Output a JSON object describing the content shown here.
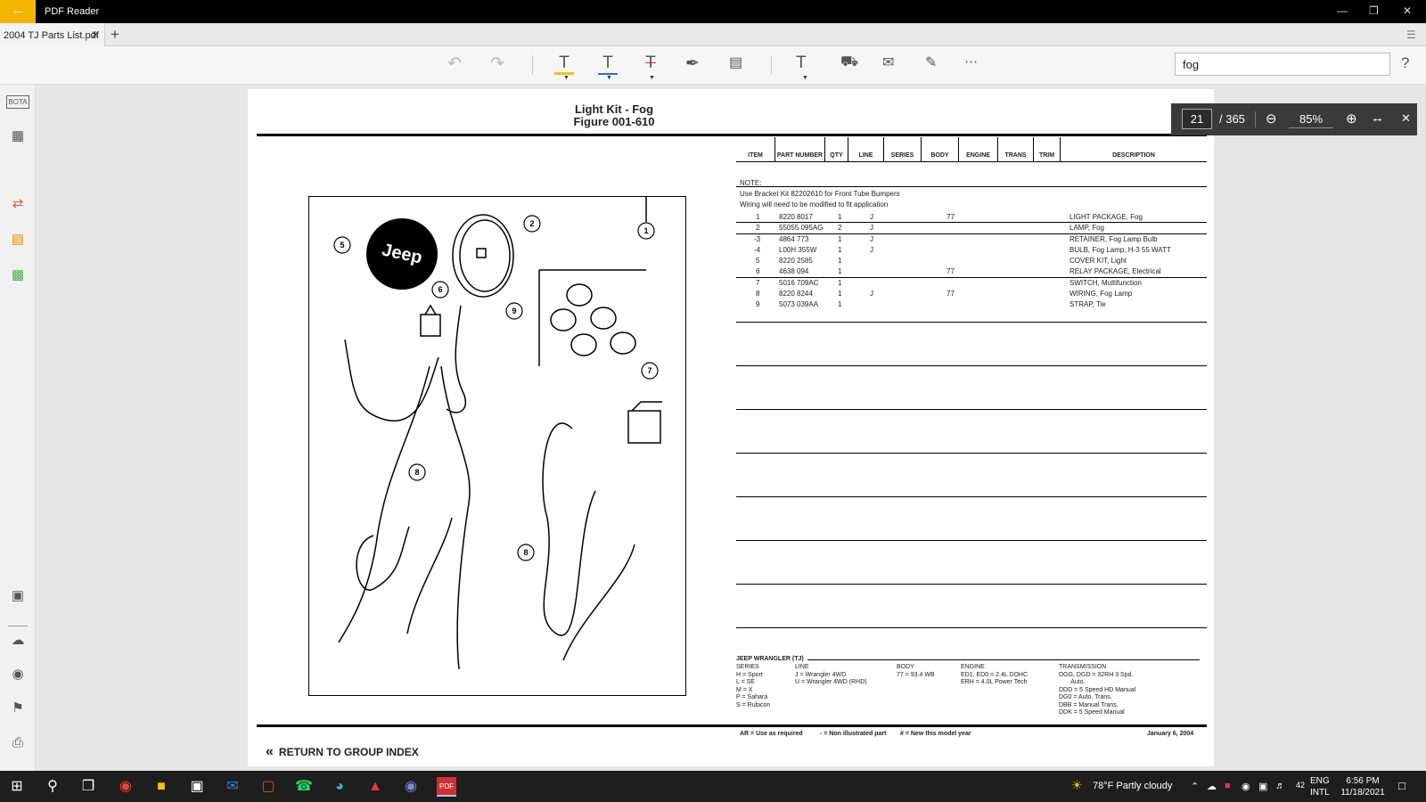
{
  "app": {
    "title": "PDF Reader"
  },
  "tab": {
    "label": "2004 TJ Parts List.pdf"
  },
  "search": {
    "value": "fog"
  },
  "sidebar": {
    "bota": "BOTA"
  },
  "page": {
    "title": "Light Kit - Fog",
    "figure": "Figure 001-610"
  },
  "pagectl": {
    "page": "21",
    "total": "/ 365",
    "zoom": "85%"
  },
  "table": {
    "headers": [
      "ITEM",
      "PART NUMBER",
      "QTY",
      "LINE",
      "SERIES",
      "BODY",
      "ENGINE",
      "TRANS",
      "TRIM",
      "DESCRIPTION"
    ],
    "notes": [
      "NOTE:",
      "Use Bracket Kit 82202610 for Front Tube Bumpers",
      "Wiring will need to be modified to fit application"
    ],
    "rows": [
      {
        "item": "1",
        "part": "8220 8017",
        "qty": "1",
        "line": "J",
        "body": "77",
        "desc": "LIGHT PACKAGE, Fog"
      },
      {
        "item": "2",
        "part": "55055 095AG",
        "qty": "2",
        "line": "J",
        "body": "",
        "desc": "LAMP, Fog"
      },
      {
        "item": "-3",
        "part": "4864 773",
        "qty": "1",
        "line": "J",
        "body": "",
        "desc": "RETAINER, Fog Lamp Bulb"
      },
      {
        "item": "-4",
        "part": "L00H 355W",
        "qty": "1",
        "line": "J",
        "body": "",
        "desc": "BULB, Fog Lamp, H-3 55 WATT"
      },
      {
        "item": "5",
        "part": "8220 2585",
        "qty": "1",
        "line": "",
        "body": "",
        "desc": "COVER KIT, Light"
      },
      {
        "item": "6",
        "part": "4638 094",
        "qty": "1",
        "line": "",
        "body": "77",
        "desc": "RELAY PACKAGE, Electrical"
      },
      {
        "item": "7",
        "part": "5016 709AC",
        "qty": "1",
        "line": "",
        "body": "",
        "desc": "SWITCH, Multifunction"
      },
      {
        "item": "8",
        "part": "8220 8244",
        "qty": "1",
        "line": "J",
        "body": "77",
        "desc": "WIRING, Fog Lamp"
      },
      {
        "item": "9",
        "part": "5073 039AA",
        "qty": "1",
        "line": "",
        "body": "",
        "desc": "STRAP, Tie"
      }
    ]
  },
  "figure": {
    "logo": "Jeep",
    "callouts": [
      "1",
      "2",
      "5",
      "6",
      "9",
      "7",
      "8",
      "8"
    ]
  },
  "legend": {
    "title": "JEEP WRANGLER (TJ)",
    "series": "SERIES\nH = Sport\nL = SE\nM = X\nP = Sahara\nS = Rubicon",
    "line": "LINE\nJ = Wrangler 4WD\nU = Wrangler 4WD (RHD)",
    "body": "BODY\n77 = 93.4 WB",
    "engine": "ENGINE\nED1, ED0 = 2.4L DOHC\nERH = 4.0L Power Tech",
    "trans": "TRANSMISSION\nDGG, DGD = 32RH 3 Spd.\n       Auto.\nDDD = 5 Speed HD Manual\nDG0 = Auto. Trans.\nDBB = Manual Trans.\nDDK = 5 Speed Manual"
  },
  "footer": {
    "ar": "AR = Use as required",
    "non": "- = Non illustrated part",
    "new": "# = New this model year",
    "date": "January 6, 2004",
    "return": "RETURN TO GROUP INDEX"
  },
  "taskbar": {
    "weather": "78°F  Partly cloudy",
    "lang1": "ENG",
    "lang2": "INTL",
    "vol": "42",
    "time": "6:56 PM",
    "date": "11/18/2021"
  }
}
